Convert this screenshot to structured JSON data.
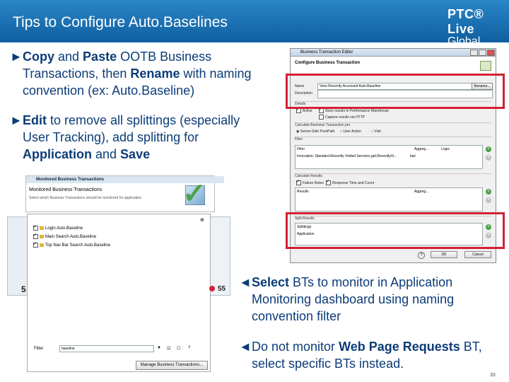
{
  "header": {
    "title": "Tips to Configure Auto.Baselines",
    "logo_line1": "PTC® Live",
    "logo_line2": "Global"
  },
  "bullets": {
    "b1": {
      "p1": "Copy",
      "p2": " and ",
      "p3": "Paste",
      "p4": " OOTB Business",
      "l2": "Transactions, then ",
      "l2b": "Rename",
      "l2c": " with naming",
      "l3": "convention (ex: Auto.Baseline)"
    },
    "b2": {
      "p1": "Edit",
      "p2": " to remove all splittings (especially",
      "l2": "User Tracking), add splitting for",
      "l3a": "Application",
      "l3b": " and ",
      "l3c": "Save"
    },
    "b3": {
      "p1": "Select",
      "p2": " BTs to monitor in Application",
      "l2": "Monitoring dashboard using naming",
      "l3": "convention filter"
    },
    "b4": {
      "p1": "Do not monitor ",
      "p2": "Web Page Requests",
      "p3": " BT,",
      "l2": "select specific BTs instead."
    }
  },
  "dialog": {
    "title": "Business Transaction Editor",
    "heading": "Configure Business Transaction",
    "name_label": "Name",
    "name_value": "View Recently Accessed Auto.Baseline",
    "rename_btn": "Rename...",
    "desc_label": "Description",
    "details_label": "Details",
    "active_label": "Active",
    "store_label": "Store results in Performance Warehouse",
    "capture_label": "Capture results via HTTP",
    "calc_trans_label": "Calculate Business Transaction per",
    "opt_server": "Server-Side PurePath",
    "opt_user": "User Action",
    "opt_visit": "Visit",
    "filter_label": "Filter",
    "col_filter": "Filter",
    "col_aggreg": "Aggreg...",
    "col_logic": "Logic",
    "filter_value": "Invocation: Standard.Recently Visited Services.get.RecentlyVi...",
    "filter_last": "last",
    "calc_results_label": "Calculate Results",
    "failure_rates": "Failure Rates",
    "response_time": "Response Time and Count",
    "col_results": "Results",
    "col_aggreg2": "Aggreg...",
    "split_label": "Split Results",
    "col_splittings": "Splittings",
    "split_value": "Application",
    "ok": "OK",
    "cancel": "Cancel"
  },
  "left_panel": {
    "header": "Monitored Business Transactions",
    "title": "Monitored Business Transactions",
    "subtitle": "Select which Business Transactions should be monitored for application.",
    "items": [
      "Login Auto.Baseline",
      "Main Search Auto.Baseline",
      "Top Nav Bar Search Auto.Baseline"
    ],
    "filter_label": "Filter",
    "filter_value": "baseline",
    "manage_btn": "Manage Business Transactions...",
    "badge_count": "55",
    "left_letter": "5"
  },
  "page_number": "33",
  "colors": {
    "header": "#1a6fb3",
    "bullet_text": "#0c3c78",
    "highlight": "#d42035"
  }
}
